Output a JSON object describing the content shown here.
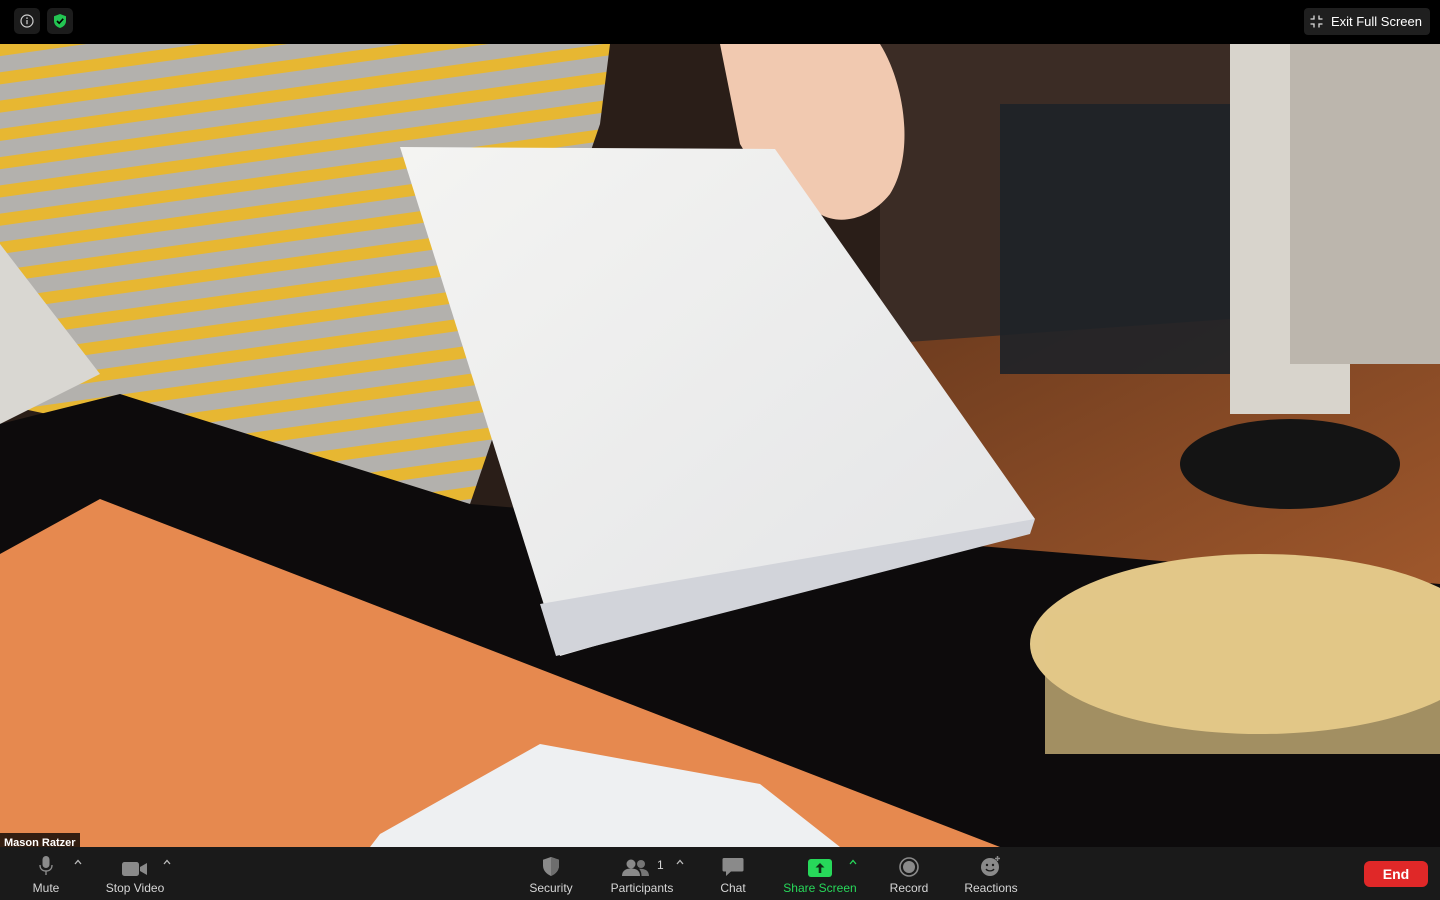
{
  "topbar": {
    "info_icon": "info-icon",
    "security_badge_icon": "shield-check-icon",
    "exit_fullscreen_label": "Exit Full Screen"
  },
  "video": {
    "participant_name": "Mason Ratzer"
  },
  "toolbar": {
    "mute_label": "Mute",
    "stop_video_label": "Stop Video",
    "security_label": "Security",
    "participants_label": "Participants",
    "participants_count": "1",
    "chat_label": "Chat",
    "share_screen_label": "Share Screen",
    "record_label": "Record",
    "reactions_label": "Reactions",
    "end_label": "End"
  },
  "colors": {
    "toolbar_bg": "#1a1a1a",
    "share_accent": "#27d85a",
    "end_button": "#e02828",
    "shield_badge": "#23c552"
  }
}
